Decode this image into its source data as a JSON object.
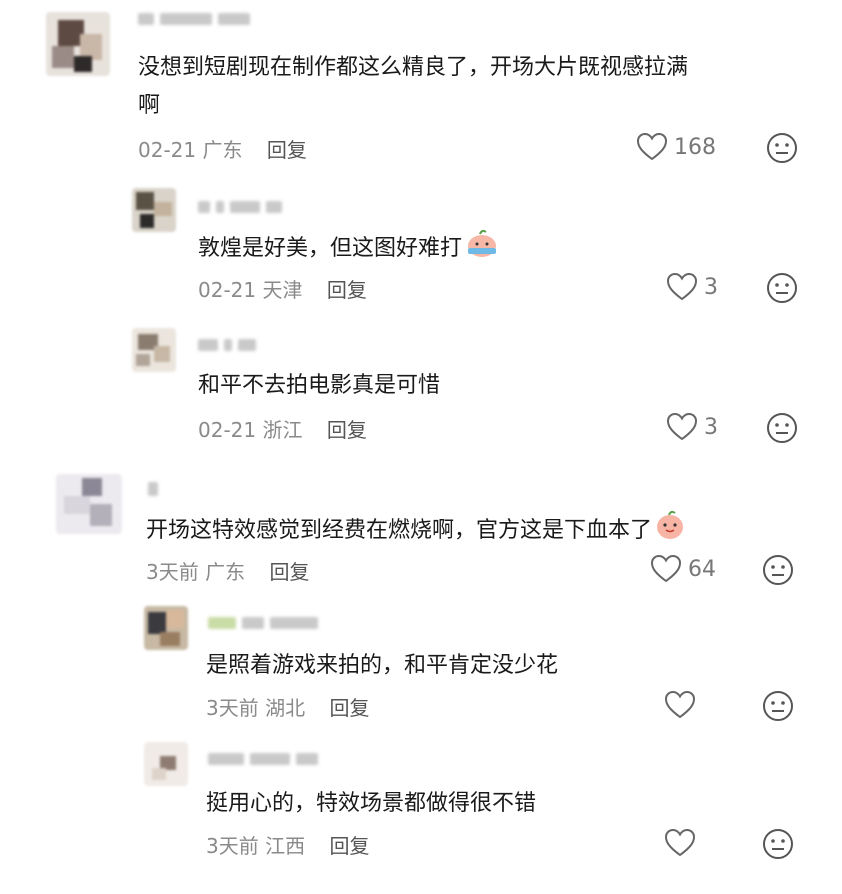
{
  "comments": [
    {
      "text_line1": "没想到短剧现在制作都这么精良了，开场大片既视感拉满",
      "text_line2": "啊",
      "date": "02-21",
      "location": "广东",
      "reply_label": "回复",
      "likes": "168"
    },
    {
      "text": "敦煌是好美，但这图好难打",
      "emoji": "crying-peach-icon",
      "date": "02-21",
      "location": "天津",
      "reply_label": "回复",
      "likes": "3"
    },
    {
      "text": "和平不去拍电影真是可惜",
      "date": "02-21",
      "location": "浙江",
      "reply_label": "回复",
      "likes": "3"
    },
    {
      "text": "开场这特效感觉到经费在燃烧啊，官方这是下血本了",
      "emoji": "smiling-peach-icon",
      "date": "3天前",
      "location": "广东",
      "reply_label": "回复",
      "likes": "64"
    },
    {
      "text": "是照着游戏来拍的，和平肯定没少花",
      "date": "3天前",
      "location": "湖北",
      "reply_label": "回复",
      "likes": ""
    },
    {
      "text": "挺用心的，特效场景都做得很不错",
      "date": "3天前",
      "location": "江西",
      "reply_label": "回复",
      "likes": ""
    }
  ],
  "colors": {
    "text": "#1a1a1a",
    "meta": "#8a8a8a",
    "icon": "#777777"
  }
}
